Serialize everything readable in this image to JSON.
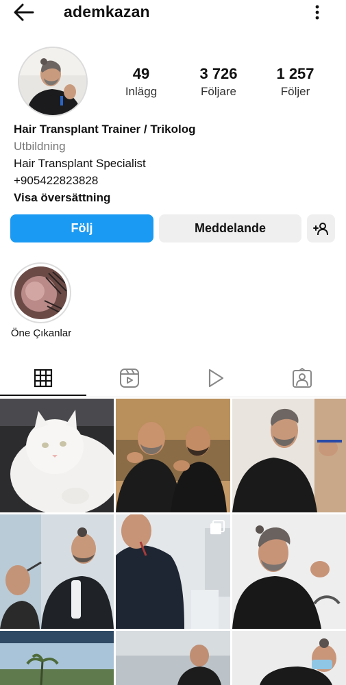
{
  "header": {
    "username": "ademkazan",
    "back_icon": "arrow-left-icon",
    "menu_icon": "kebab-menu-icon"
  },
  "profile": {
    "stats": [
      {
        "value": "49",
        "label": "Inlägg"
      },
      {
        "value": "3 726",
        "label": "Följare"
      },
      {
        "value": "1 257",
        "label": "Följer"
      }
    ],
    "name": "Hair Transplant Trainer / Trikolog",
    "category": "Utbildning",
    "bio_line1": "Hair Transplant Specialist",
    "bio_line2": "+905422823828",
    "translate_label": "Visa översättning"
  },
  "actions": {
    "follow_label": "Följ",
    "message_label": "Meddelande",
    "add_user_icon": "add-person-icon"
  },
  "highlights": [
    {
      "label": "Öne Çıkanlar"
    }
  ],
  "tabs": [
    {
      "icon": "grid-icon",
      "active": true
    },
    {
      "icon": "reels-icon",
      "active": false
    },
    {
      "icon": "play-icon",
      "active": false
    },
    {
      "icon": "tagged-icon",
      "active": false
    }
  ],
  "colors": {
    "accent": "#1a9af2",
    "secondary_button": "#efefef",
    "muted_text": "#777777"
  }
}
